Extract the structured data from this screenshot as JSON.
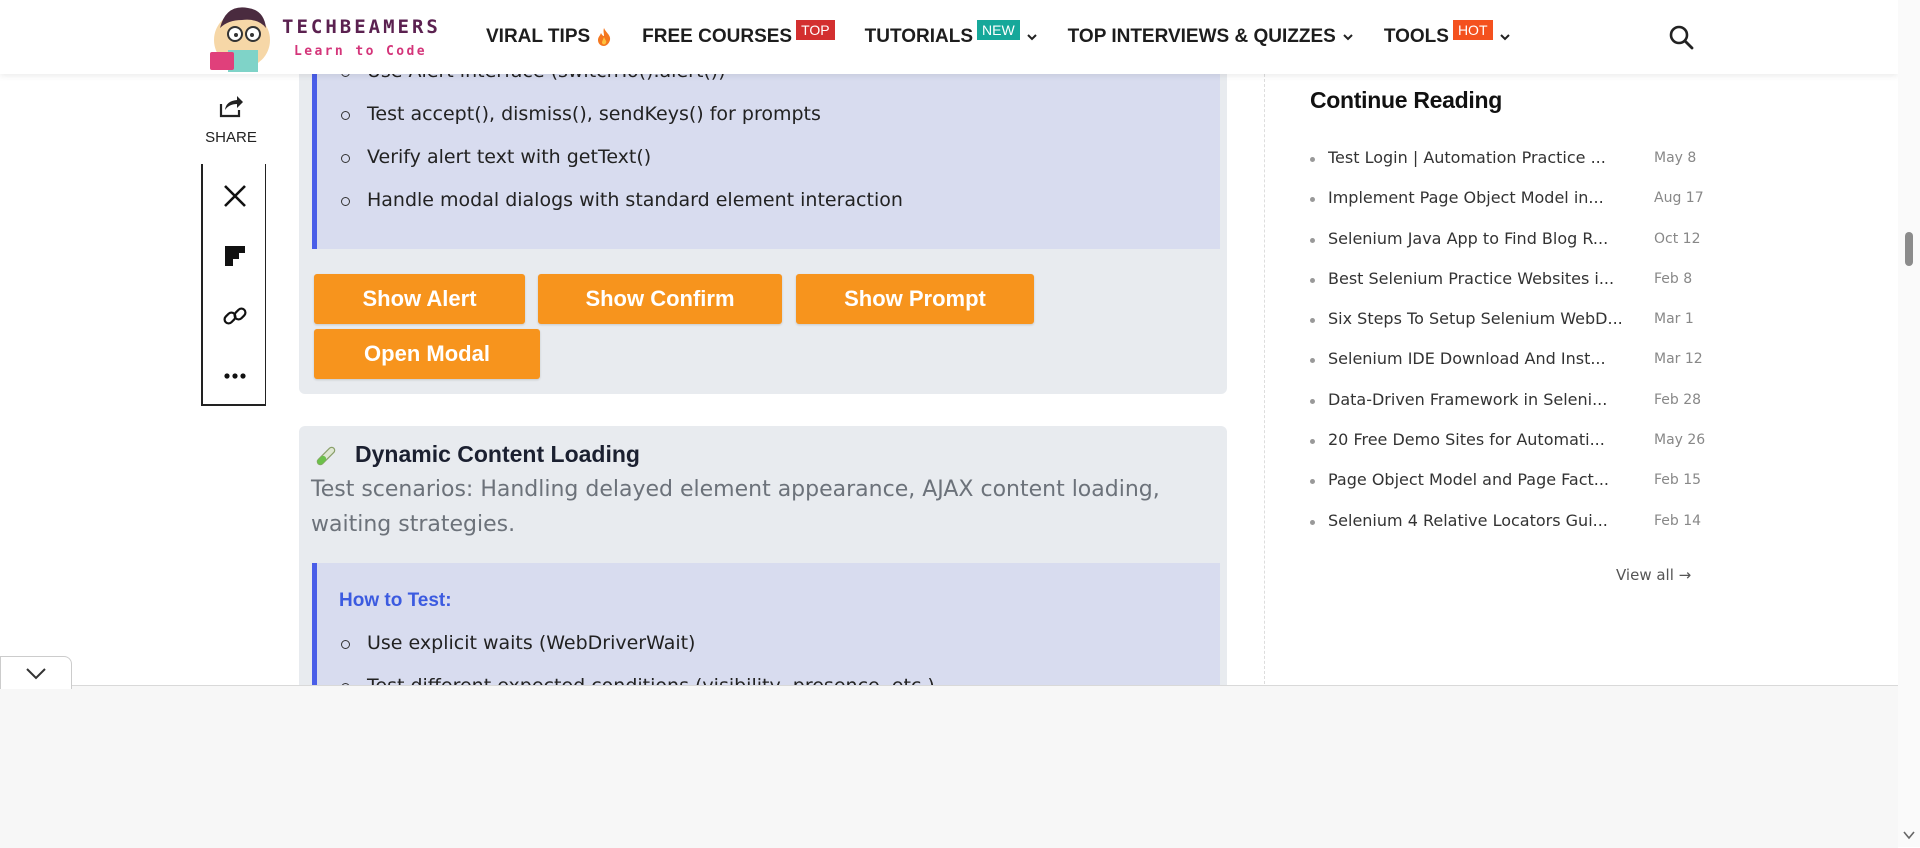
{
  "header": {
    "logo_title": "TECHBEAMERS",
    "logo_subtitle": "Learn to Code",
    "nav": [
      {
        "label": "VIRAL TIPS",
        "icon": "fire-icon"
      },
      {
        "label": "FREE COURSES",
        "badge": "TOP",
        "badge_color": "#d32f2f"
      },
      {
        "label": "TUTORIALS",
        "badge": "NEW",
        "badge_color": "#16a89a",
        "dropdown": true
      },
      {
        "label": "TOP INTERVIEWS & QUIZZES",
        "dropdown": true
      },
      {
        "label": "TOOLS",
        "badge": "HOT",
        "badge_color": "#f4511e",
        "dropdown": true
      }
    ],
    "search_icon": "search-icon"
  },
  "share": {
    "label": "SHARE",
    "buttons": [
      "x-icon",
      "flipboard-icon",
      "link-icon",
      "more-icon"
    ]
  },
  "alerts_section": {
    "list": [
      "Use Alert interface (switchTo().alert())",
      "Test accept(), dismiss(), sendKeys() for prompts",
      "Verify alert text with getText()",
      "Handle modal dialogs with standard element interaction"
    ],
    "buttons": {
      "show_alert": "Show Alert",
      "show_confirm": "Show Confirm",
      "show_prompt": "Show Prompt",
      "open_modal": "Open Modal"
    }
  },
  "dynamic_section": {
    "icon": "test-tube-icon",
    "title": "Dynamic Content Loading",
    "description": "Test scenarios: Handling delayed element appearance, AJAX content loading, waiting strategies.",
    "how_to_title": "How to Test:",
    "list": [
      "Use explicit waits (WebDriverWait)",
      "Test different expected conditions (visibility, presence, etc.)"
    ]
  },
  "sidebar": {
    "title": "Continue Reading",
    "items": [
      {
        "title": "Test Login | Automation Practice ...",
        "date": "May 8"
      },
      {
        "title": "Implement Page Object Model in...",
        "date": "Aug 17"
      },
      {
        "title": "Selenium Java App to Find Blog R...",
        "date": "Oct 12"
      },
      {
        "title": "Best Selenium Practice Websites i...",
        "date": "Feb 8"
      },
      {
        "title": "Six Steps To Setup Selenium WebD...",
        "date": "Mar 1"
      },
      {
        "title": "Selenium IDE Download And Inst...",
        "date": "Mar 12"
      },
      {
        "title": "Data-Driven Framework in Seleni...",
        "date": "Feb 28"
      },
      {
        "title": "20 Free Demo Sites for Automati...",
        "date": "May 26"
      },
      {
        "title": "Page Object Model and Page Fact...",
        "date": "Feb 15"
      },
      {
        "title": "Selenium 4 Relative Locators Gui...",
        "date": "Feb 14"
      }
    ],
    "view_all": "View all →"
  },
  "colors": {
    "accent_orange": "#f7941d",
    "howto_blue": "#3c5be0",
    "howto_bg": "#d8dcef",
    "card_bg": "#e8ebef"
  }
}
